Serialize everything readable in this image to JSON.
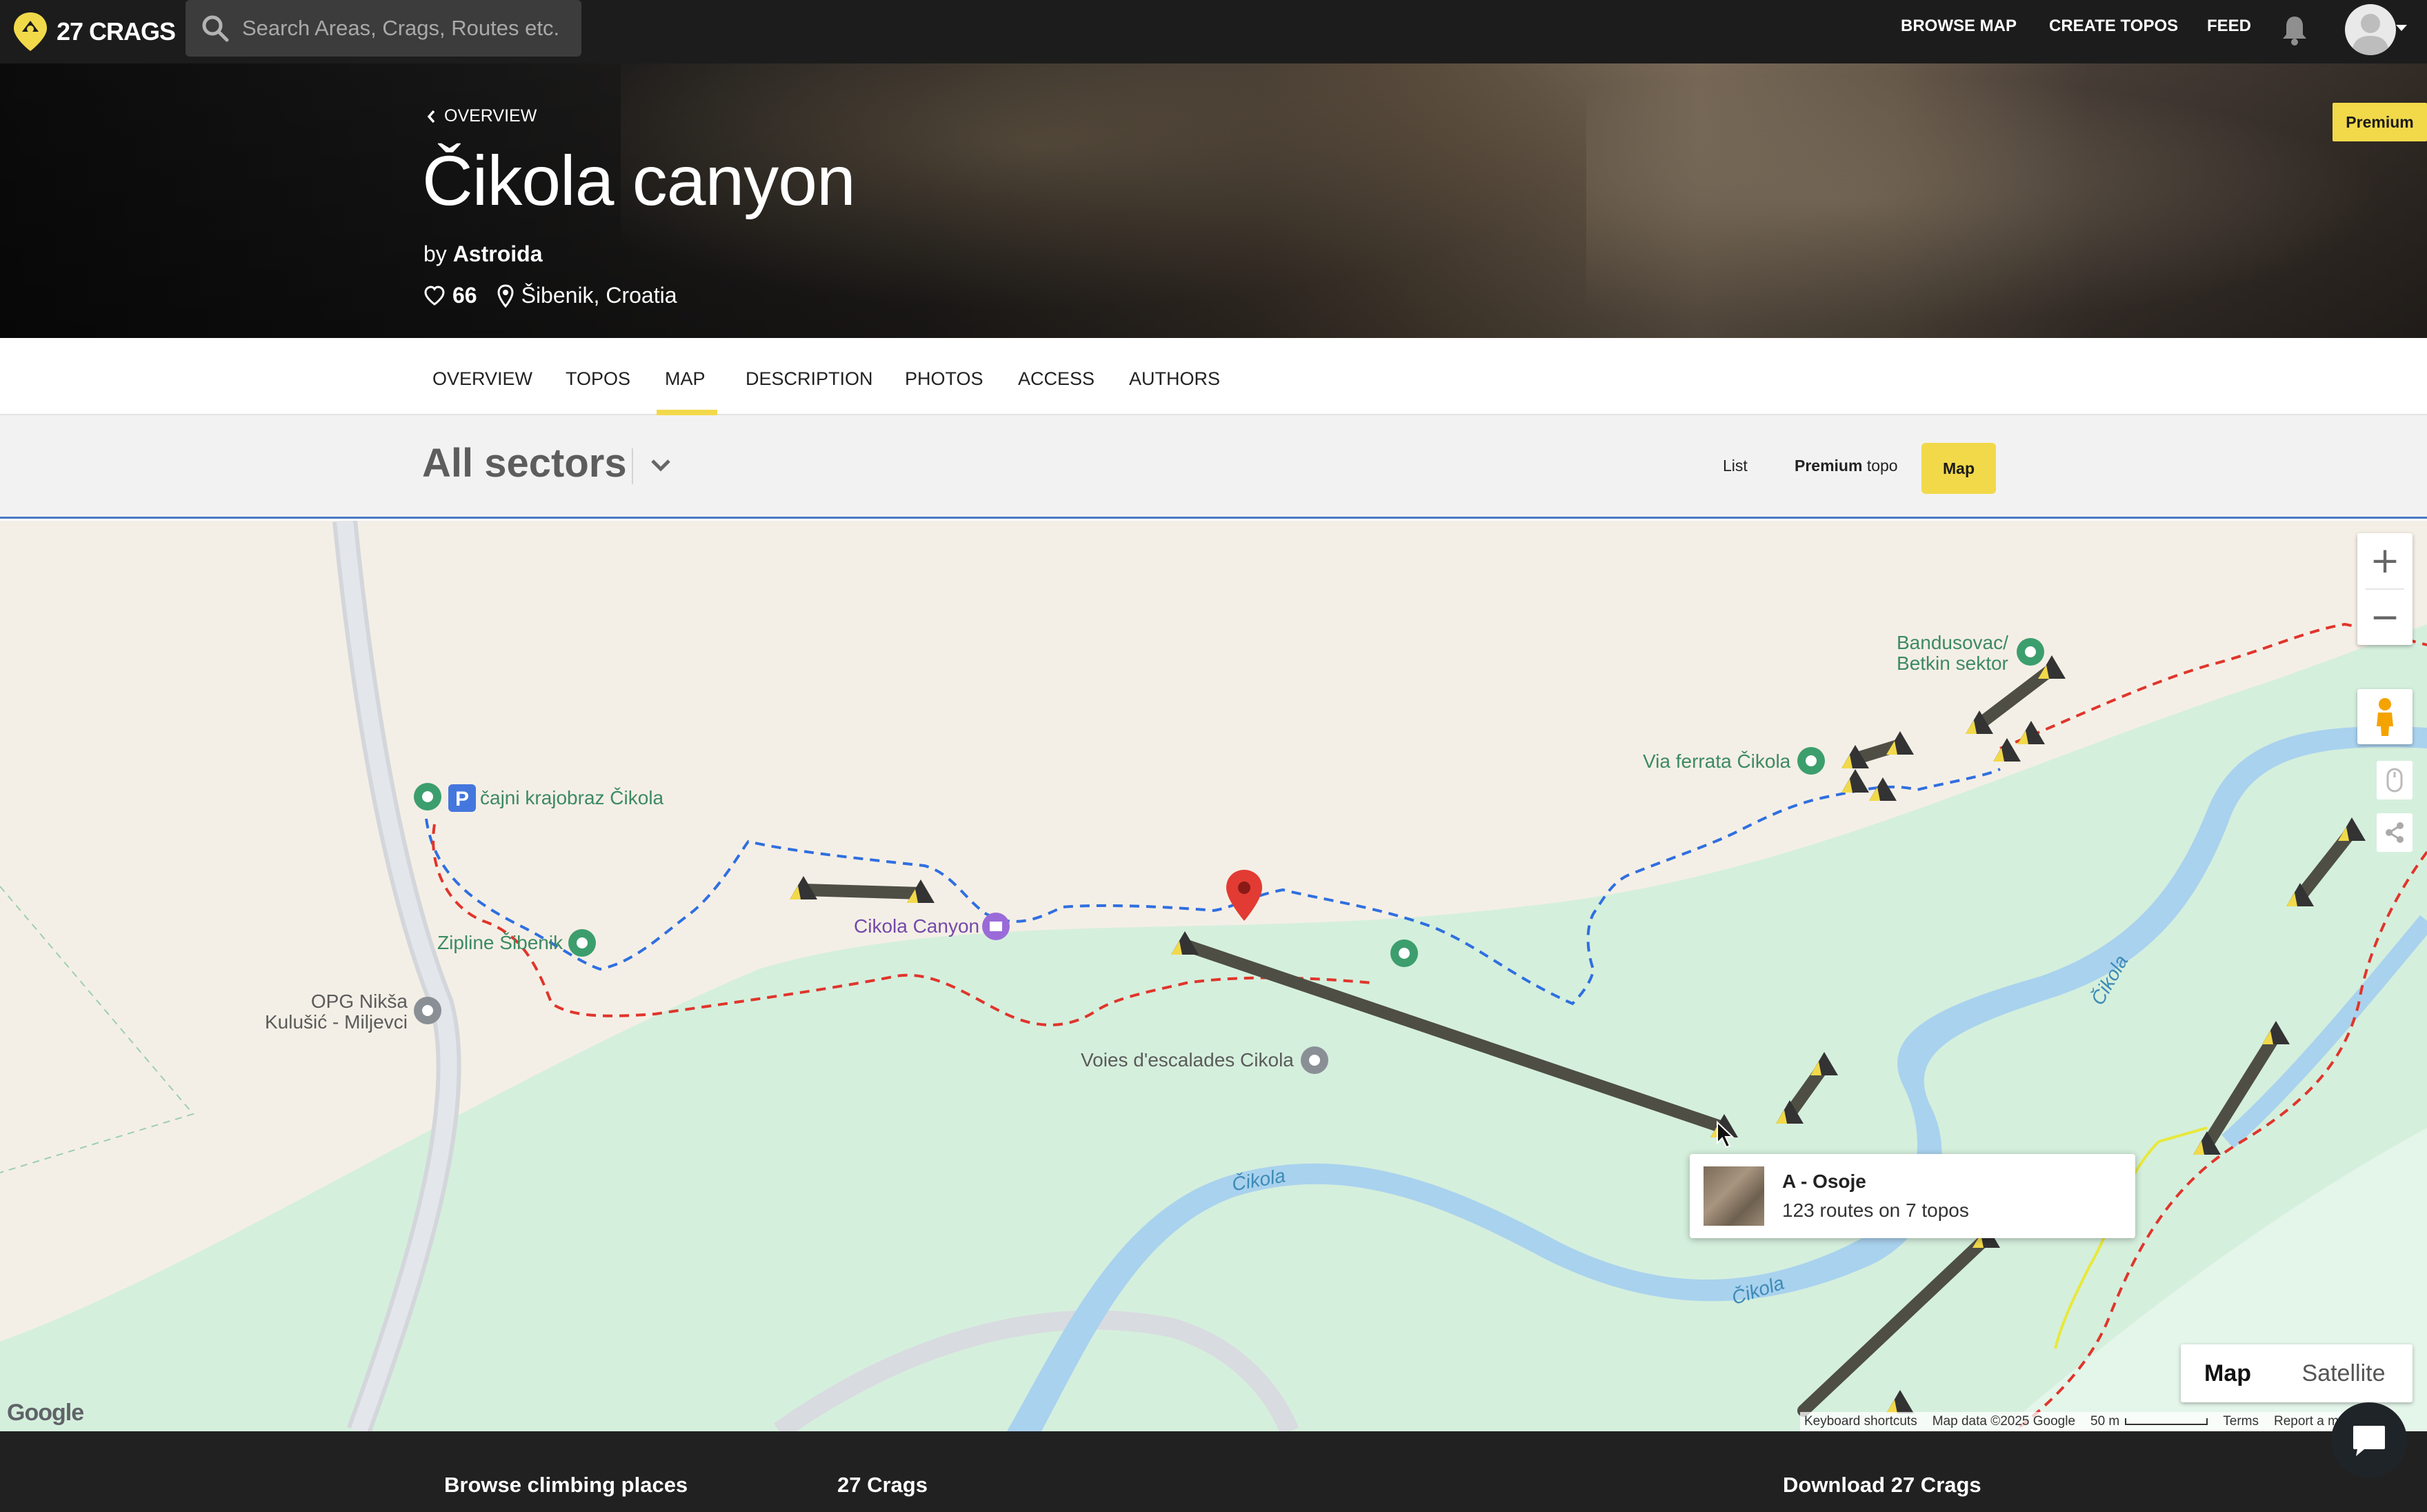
{
  "topbar": {
    "logo_text": "27 CRAGS",
    "search_placeholder": "Search Areas, Crags, Routes etc.",
    "nav": [
      "BROWSE MAP",
      "CREATE TOPOS",
      "FEED"
    ]
  },
  "hero": {
    "back_label": "OVERVIEW",
    "title": "Čikola canyon",
    "by_prefix": "by",
    "author": "Astroida",
    "likes": "66",
    "location": "Šibenik, Croatia",
    "premium_badge": "Premium"
  },
  "tabs": {
    "items": [
      "OVERVIEW",
      "TOPOS",
      "MAP",
      "DESCRIPTION",
      "PHOTOS",
      "ACCESS",
      "AUTHORS"
    ],
    "active": "MAP"
  },
  "sectors": {
    "title": "All sectors",
    "view_list": "List",
    "view_premium_bold": "Premium",
    "view_premium_rest": " topo",
    "view_map": "Map"
  },
  "map": {
    "labels": {
      "bandusovac": "Bandusovac/\nBetkin sektor",
      "via_ferrata": "Via ferrata Čikola",
      "krajobraz": "čajni krajobraz Čikola",
      "zipline": "Zipline Šibenik",
      "opg": "OPG Nikša\nKulušić - Miljevci",
      "cikola_canyon": "Cikola Canyon",
      "voies": "Voies d'escalades Cikola",
      "river1": "Čikola",
      "river2": "Čikola",
      "river3": "Čikola"
    },
    "popup": {
      "title": "A - Osoje",
      "subtitle": "123 routes on 7 topos"
    },
    "map_type": {
      "map": "Map",
      "satellite": "Satellite"
    },
    "google": "Google",
    "attribution": {
      "shortcuts": "Keyboard shortcuts",
      "data": "Map data ©2025 Google",
      "scale": "50 m",
      "terms": "Terms",
      "report": "Report a map error"
    }
  },
  "footer": {
    "col1": "Browse climbing places",
    "col2": "27 Crags",
    "col3": "Download 27 Crags"
  },
  "colors": {
    "accent_yellow": "#f2d94a",
    "topbar_bg": "#1c1c1c",
    "map_land": "#f4efe6",
    "map_park": "#d5efdd",
    "river": "#a9d2ee",
    "trail_blue": "#2f6fe0",
    "trail_red": "#e0352b",
    "sector_line": "#4e4e44"
  }
}
